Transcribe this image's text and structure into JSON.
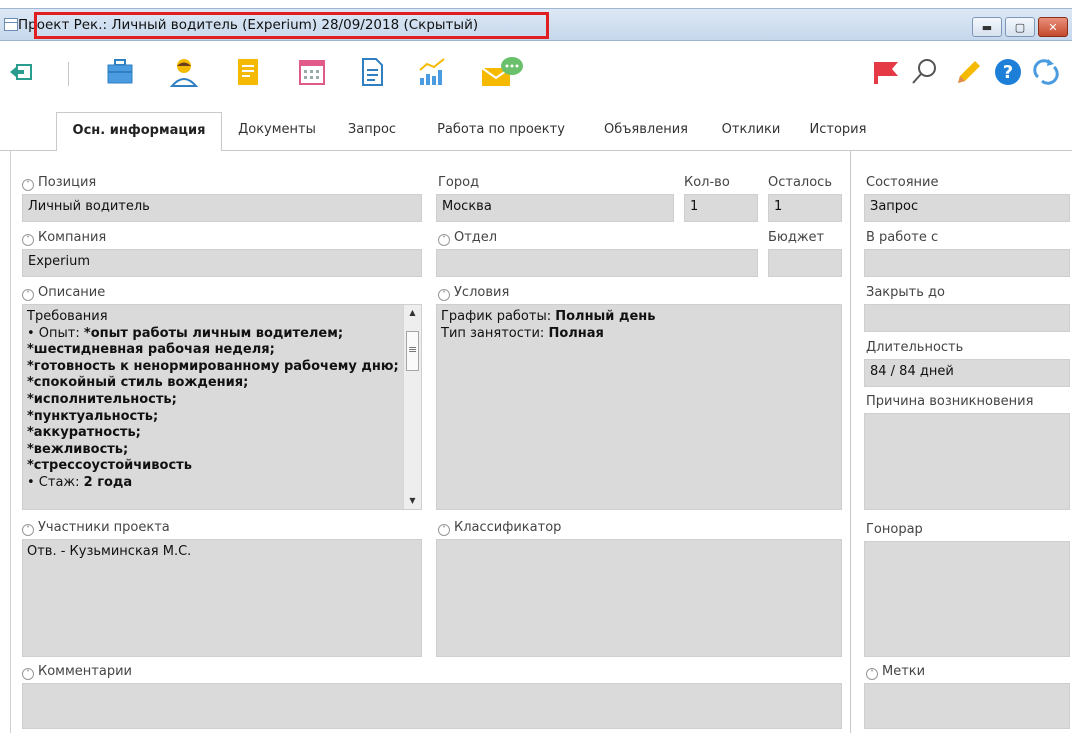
{
  "window": {
    "title": "Проект Рек.: Личный водитель (Experium) 28/09/2018 (Скрытый)",
    "minimize": "▬",
    "maximize": "▢",
    "close": "✕"
  },
  "toolbar": {
    "icons": [
      "back-icon",
      "briefcase-icon",
      "person-icon",
      "notes-icon",
      "calendar-icon",
      "document-icon",
      "stats-icon",
      "mail-chat-icon",
      "flag-icon",
      "search-icon",
      "pencil-icon",
      "help-icon",
      "refresh-icon"
    ],
    "colors": {
      "flag": "#e53945",
      "help": "#1e7fd8",
      "accent": "#4a9be0",
      "yellow": "#f5b900",
      "green": "#6bc06b"
    }
  },
  "tabs": [
    {
      "label": "Осн. информация",
      "active": true
    },
    {
      "label": "Документы"
    },
    {
      "label": "Запрос"
    },
    {
      "label": "Работа по проекту"
    },
    {
      "label": "Объявления"
    },
    {
      "label": "Отклики"
    },
    {
      "label": "История"
    }
  ],
  "fields": {
    "position_label": "Позиция",
    "position_value": "Личный водитель",
    "city_label": "Город",
    "city_value": "Москва",
    "qty_label": "Кол-во",
    "qty_value": "1",
    "remain_label": "Осталось",
    "remain_value": "1",
    "state_label": "Состояние",
    "state_value": "Запрос",
    "company_label": "Компания",
    "company_value": "Experium",
    "dept_label": "Отдел",
    "budget_label": "Бюджет",
    "inwork_label": "В работе с",
    "description_label": "Описание",
    "conditions_label": "Условия",
    "close_by_label": "Закрыть до",
    "duration_label": "Длительность",
    "duration_value": "84 / 84 дней",
    "reason_label": "Причина возникновения",
    "participants_label": "Участники проекта",
    "participants_value": "Отв. - Кузьминская М.С.",
    "classifier_label": "Классификатор",
    "fee_label": "Гонорар",
    "comments_label": "Комментарии",
    "tags_label": "Метки"
  },
  "description": {
    "heading": "Требования",
    "exp_prefix": "• Опыт: ",
    "exp_value": "*опыт работы личным водителем;",
    "lines": [
      "*шестидневная рабочая неделя;",
      "*готовность к ненормированному рабочему дню;",
      "*спокойный стиль вождения;",
      "*исполнительность;",
      "*пунктуальность;",
      "*аккуратность;",
      "*вежливость;",
      "*стрессоустойчивость"
    ],
    "stage_prefix": "• Стаж: ",
    "stage_value": "2 года"
  },
  "conditions": {
    "schedule_label": "График работы: ",
    "schedule_value": "Полный день",
    "employment_label": "Тип занятости: ",
    "employment_value": "Полная"
  }
}
